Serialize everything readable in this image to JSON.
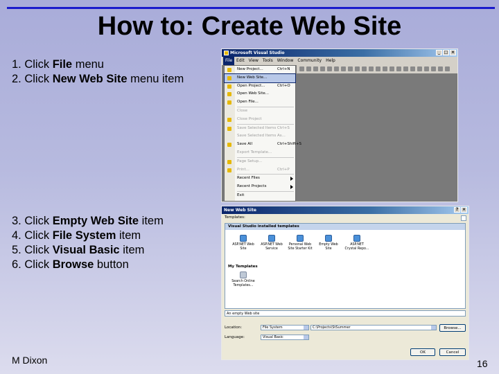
{
  "title": "How to: Create Web Site",
  "steps_top": [
    {
      "num": "1.",
      "pre": "Click",
      "bold": "File",
      "post": "menu"
    },
    {
      "num": "2.",
      "pre": "Click",
      "bold": "New Web Site",
      "post": "menu item"
    }
  ],
  "steps_bottom": [
    {
      "num": "3.",
      "pre": "Click",
      "bold": "Empty Web Site",
      "post": "item"
    },
    {
      "num": "4.",
      "pre": "Click",
      "bold": "File System",
      "post": "item"
    },
    {
      "num": "5.",
      "pre": "Click",
      "bold": "Visual Basic",
      "post": "item"
    },
    {
      "num": "6.",
      "pre": "Click",
      "bold": "Browse",
      "post": "button"
    }
  ],
  "footer": "M Dixon",
  "page_number": "16",
  "colors": {
    "accent_rule": "#1a1acc",
    "titlebar": "#0a246a"
  },
  "vs_window": {
    "title": "Microsoft Visual Studio",
    "menubar": [
      "File",
      "Edit",
      "View",
      "Tools",
      "Window",
      "Community",
      "Help"
    ],
    "file_menu": [
      {
        "label": "New Project...",
        "shortcut": "Ctrl+N",
        "state": "normal",
        "icon": true
      },
      {
        "label": "New Web Site...",
        "shortcut": "",
        "state": "highlight",
        "icon": true
      },
      {
        "label": "Open Project...",
        "shortcut": "Ctrl+O",
        "state": "normal",
        "icon": true
      },
      {
        "label": "Open Web Site...",
        "shortcut": "",
        "state": "normal",
        "icon": true
      },
      {
        "label": "Open File...",
        "shortcut": "",
        "state": "normal",
        "icon": true
      },
      {
        "sep": true
      },
      {
        "label": "Close",
        "shortcut": "",
        "state": "disabled"
      },
      {
        "label": "Close Project",
        "shortcut": "",
        "state": "disabled",
        "icon": true
      },
      {
        "sep": true
      },
      {
        "label": "Save Selected Items",
        "shortcut": "Ctrl+S",
        "state": "disabled",
        "icon": true
      },
      {
        "label": "Save Selected Items As...",
        "shortcut": "",
        "state": "disabled"
      },
      {
        "label": "Save All",
        "shortcut": "Ctrl+Shift+S",
        "state": "normal",
        "icon": true
      },
      {
        "label": "Export Template...",
        "shortcut": "",
        "state": "disabled"
      },
      {
        "sep": true
      },
      {
        "label": "Page Setup...",
        "shortcut": "",
        "state": "disabled",
        "icon": true
      },
      {
        "label": "Print...",
        "shortcut": "Ctrl+P",
        "state": "disabled",
        "icon": true
      },
      {
        "sep": true
      },
      {
        "label": "Recent Files",
        "shortcut": "",
        "state": "normal",
        "submenu": true
      },
      {
        "label": "Recent Projects",
        "shortcut": "",
        "state": "normal",
        "submenu": true
      },
      {
        "sep": true
      },
      {
        "label": "Exit",
        "shortcut": "",
        "state": "normal"
      }
    ]
  },
  "dialog": {
    "title": "New Web Site",
    "templates_label": "Templates:",
    "installed_header": "Visual Studio installed templates",
    "templates": [
      {
        "line1": "ASP.NET Web",
        "line2": "Site",
        "icon": "web-site-icon"
      },
      {
        "line1": "ASP.NET Web",
        "line2": "Service",
        "icon": "web-service-icon"
      },
      {
        "line1": "Personal Web",
        "line2": "Site Starter Kit",
        "icon": "starter-kit-icon"
      },
      {
        "line1": "Empty Web",
        "line2": "Site",
        "icon": "empty-site-icon"
      },
      {
        "line1": "ASP.NET",
        "line2": "Crystal Repo...",
        "icon": "crystal-report-icon"
      }
    ],
    "my_templates_header": "My Templates",
    "my_templates": [
      {
        "line1": "Search Online",
        "line2": "Templates...",
        "icon": "search-online-icon"
      }
    ],
    "description": "An empty Web site",
    "location_label": "Location:",
    "location_value": "File System",
    "path_value": "C:\\Projects\\StSummer",
    "language_label": "Language:",
    "language_value": "Visual Basic",
    "browse_button": "Browse...",
    "ok_button": "OK",
    "cancel_button": "Cancel"
  }
}
